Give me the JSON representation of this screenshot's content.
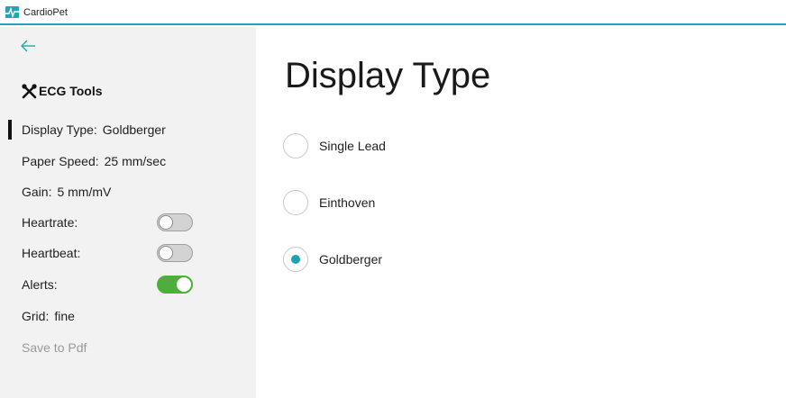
{
  "window": {
    "title": "CardioPet",
    "accent": "#2aa3b0"
  },
  "sidebar": {
    "back_icon": "back-arrow-icon",
    "header": {
      "icon": "tools-icon",
      "label": "ECG Tools"
    },
    "display_type": {
      "label": "Display Type:",
      "value": "Goldberger"
    },
    "paper_speed": {
      "label": "Paper Speed:",
      "value": "25 mm/sec"
    },
    "gain": {
      "label": "Gain:",
      "value": "5 mm/mV"
    },
    "heartrate": {
      "label": "Heartrate:",
      "on": false
    },
    "heartbeat": {
      "label": "Heartbeat:",
      "on": false
    },
    "alerts": {
      "label": "Alerts:",
      "on": true
    },
    "grid": {
      "label": "Grid:",
      "value": "fine"
    },
    "save_pdf": {
      "label": "Save to Pdf",
      "enabled": false
    }
  },
  "main": {
    "title": "Display Type",
    "options": [
      {
        "label": "Single Lead",
        "selected": false
      },
      {
        "label": "Einthoven",
        "selected": false
      },
      {
        "label": "Goldberger",
        "selected": true
      }
    ],
    "colors": {
      "toggle_on": "#4caf3b",
      "radio_selected": "#1ba3b0"
    }
  }
}
